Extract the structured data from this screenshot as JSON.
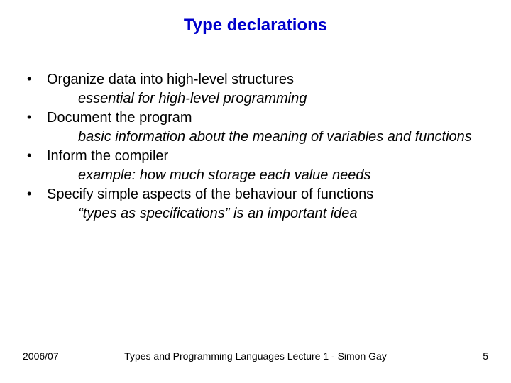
{
  "title": "Type declarations",
  "bullets": [
    {
      "main": "Organize data into high-level structures",
      "sub": "essential for high-level programming"
    },
    {
      "main": "Document the program",
      "sub": "basic information about the meaning of variables and functions"
    },
    {
      "main": "Inform the compiler",
      "sub": "example: how much storage each value needs"
    },
    {
      "main": "Specify simple aspects of the behaviour of functions",
      "sub": "“types as specifications” is an important idea"
    }
  ],
  "footer": {
    "left": "2006/07",
    "center": "Types and Programming Languages Lecture 1 - Simon Gay",
    "right": "5"
  }
}
